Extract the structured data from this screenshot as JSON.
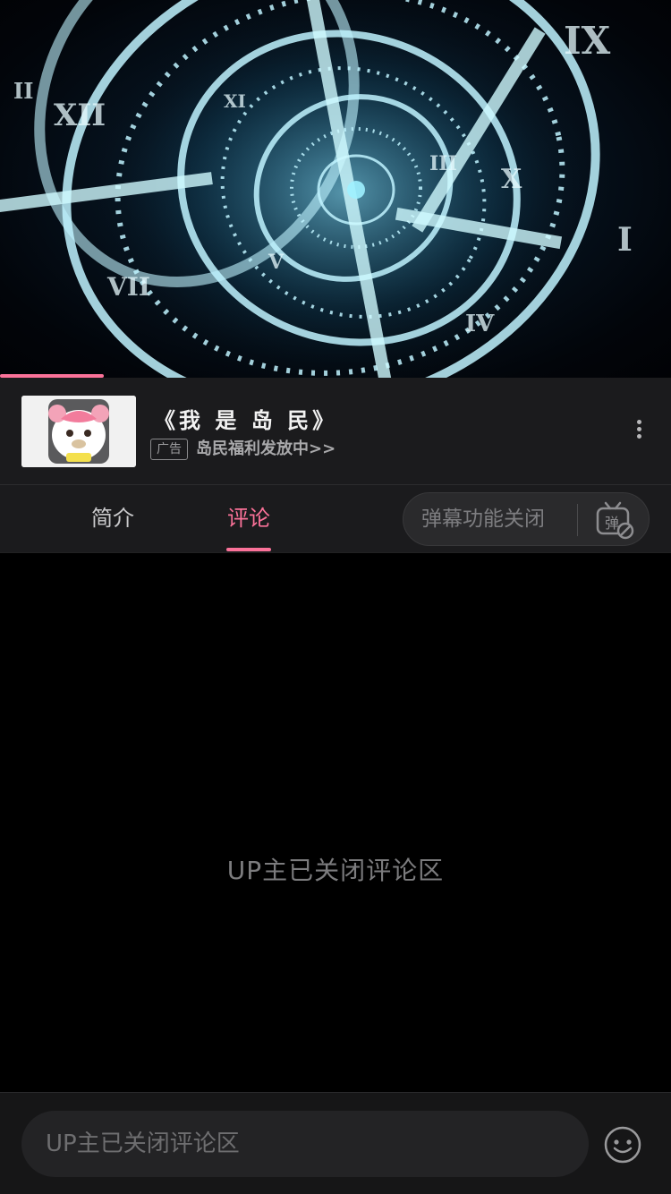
{
  "video": {
    "progress_fraction": 0.155,
    "accent": "#fb7299"
  },
  "ad": {
    "title": "《我 是 岛 民》",
    "badge": "广告",
    "subtitle": "岛民福利发放中>>",
    "thumb_icon": "bear-mascot-icon",
    "more_icon": "more-vertical-icon"
  },
  "tabs": [
    {
      "label": "简介",
      "active": false
    },
    {
      "label": "评论",
      "active": true
    }
  ],
  "danmaku": {
    "label": "弹幕功能关闭",
    "icon": "danmaku-off-icon",
    "icon_glyph": "弹"
  },
  "comments": {
    "closed_message": "UP主已关闭评论区"
  },
  "input": {
    "placeholder": "UP主已关闭评论区",
    "emoji_icon": "emoji-smile-icon"
  },
  "colors": {
    "accent": "#fb7299",
    "panel": "#1b1b1d",
    "background": "#000000"
  }
}
